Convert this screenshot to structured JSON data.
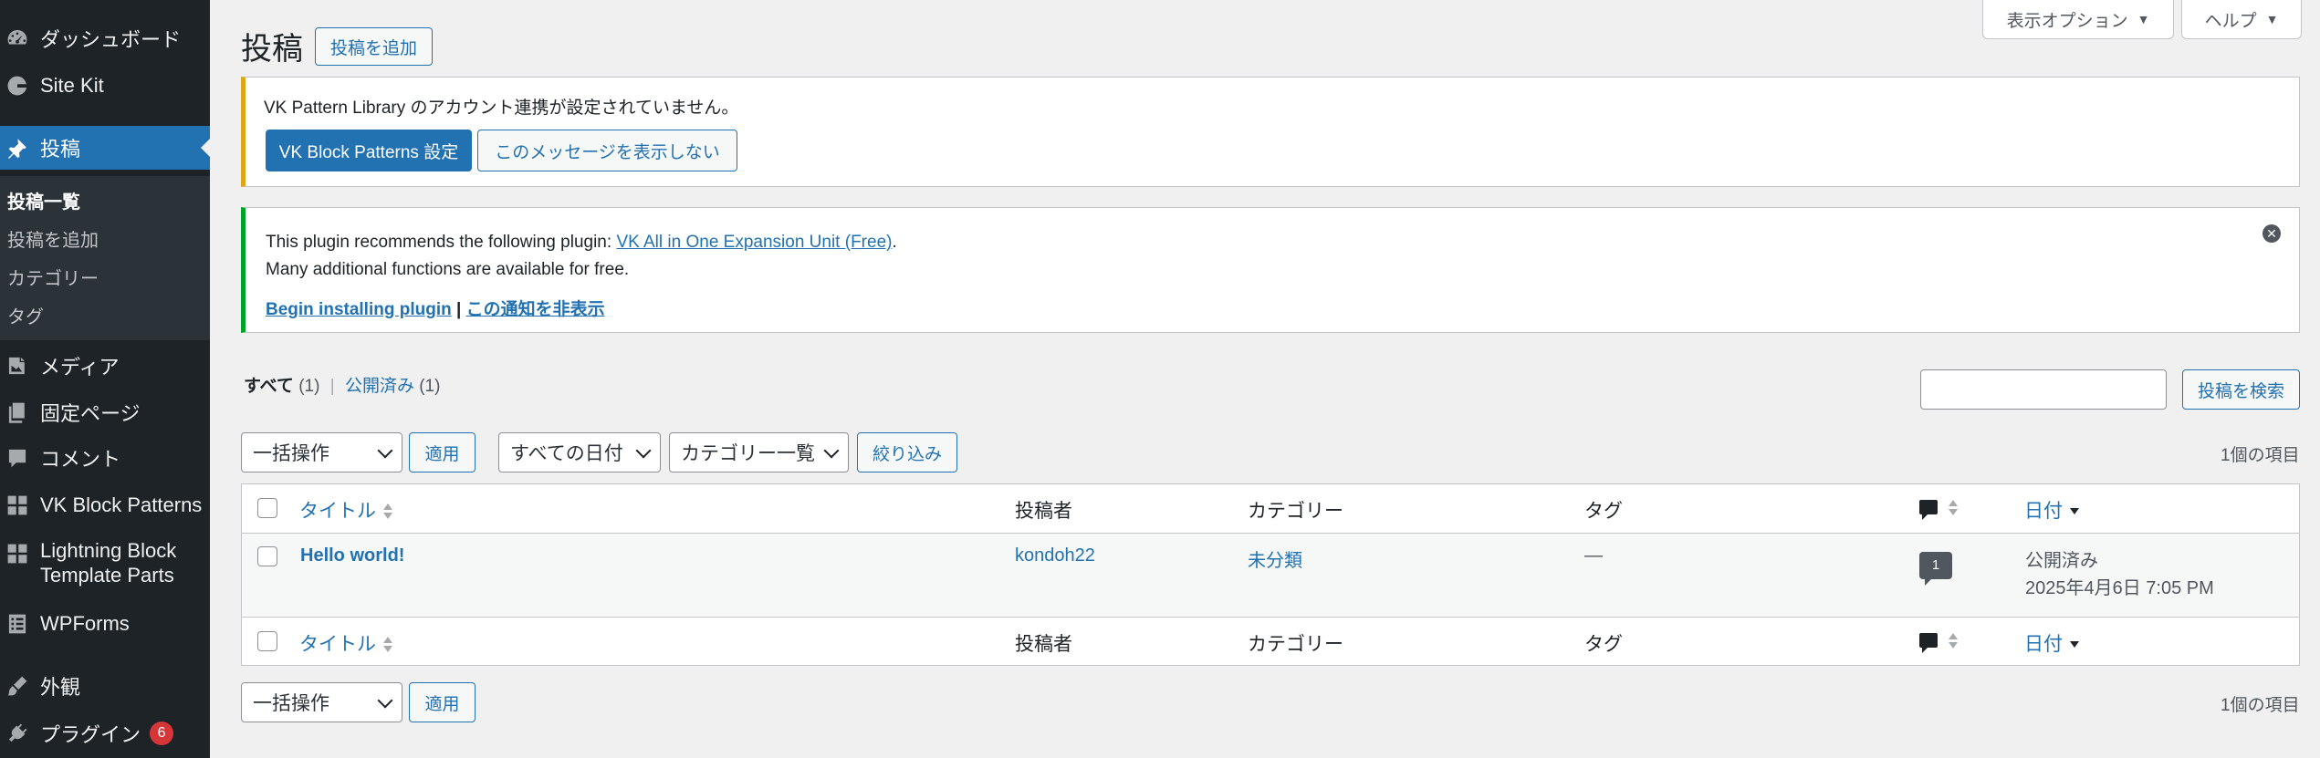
{
  "sidebar": {
    "items": [
      {
        "label": "ダッシュボード",
        "icon": "dashboard-icon"
      },
      {
        "label": "Site Kit",
        "icon": "google-icon"
      },
      {
        "label": "投稿",
        "icon": "pushpin-icon"
      },
      {
        "label": "メディア",
        "icon": "media-icon"
      },
      {
        "label": "固定ページ",
        "icon": "page-icon"
      },
      {
        "label": "コメント",
        "icon": "comment-icon"
      },
      {
        "label": "VK Block Patterns",
        "icon": "grid-icon"
      },
      {
        "label_line1": "Lightning Block",
        "label_line2": "Template Parts",
        "icon": "grid-icon"
      },
      {
        "label": "WPForms",
        "icon": "form-icon"
      },
      {
        "label": "外観",
        "icon": "brush-icon"
      },
      {
        "label": "プラグイン",
        "icon": "plugin-icon",
        "badge": "6"
      }
    ],
    "submenu": [
      "投稿一覧",
      "投稿を追加",
      "カテゴリー",
      "タグ"
    ]
  },
  "screen_meta": {
    "options_label": "表示オプション",
    "help_label": "ヘルプ"
  },
  "header": {
    "title": "投稿",
    "add_new": "投稿を追加"
  },
  "notice1": {
    "text": "VK Pattern Library のアカウント連携が設定されていません。",
    "primary_button": "VK Block Patterns 設定",
    "secondary_button": "このメッセージを表示しない"
  },
  "notice2": {
    "text_before": "This plugin recommends the following plugin: ",
    "plugin_link": "VK All in One Expansion Unit (Free)",
    "text_after": ".",
    "line2": "Many additional functions are available for free.",
    "install_link": "Begin installing plugin",
    "separator": " | ",
    "hide_link": "この通知を非表示"
  },
  "views": {
    "all": "すべて",
    "all_count": "(1)",
    "sep": "|",
    "published": "公開済み",
    "published_count": "(1)"
  },
  "search": {
    "button": "投稿を検索",
    "value": ""
  },
  "filters": {
    "bulk_action": "一括操作",
    "apply": "適用",
    "dates": "すべての日付",
    "categories": "カテゴリー一覧",
    "filter": "絞り込み",
    "items_count": "1個の項目"
  },
  "table": {
    "columns": {
      "title": "タイトル",
      "author": "投稿者",
      "categories": "カテゴリー",
      "tags": "タグ",
      "date": "日付"
    },
    "rows": [
      {
        "title": "Hello world!",
        "author": "kondoh22",
        "category": "未分類",
        "tags": "—",
        "comments": "1",
        "status": "公開済み",
        "date": "2025年4月6日 7:05 PM"
      }
    ]
  },
  "colors": {
    "accent": "#2271b1",
    "sidebar_bg": "#1d2327",
    "warning": "#dba617",
    "success": "#00a32a",
    "badge": "#d63638"
  }
}
